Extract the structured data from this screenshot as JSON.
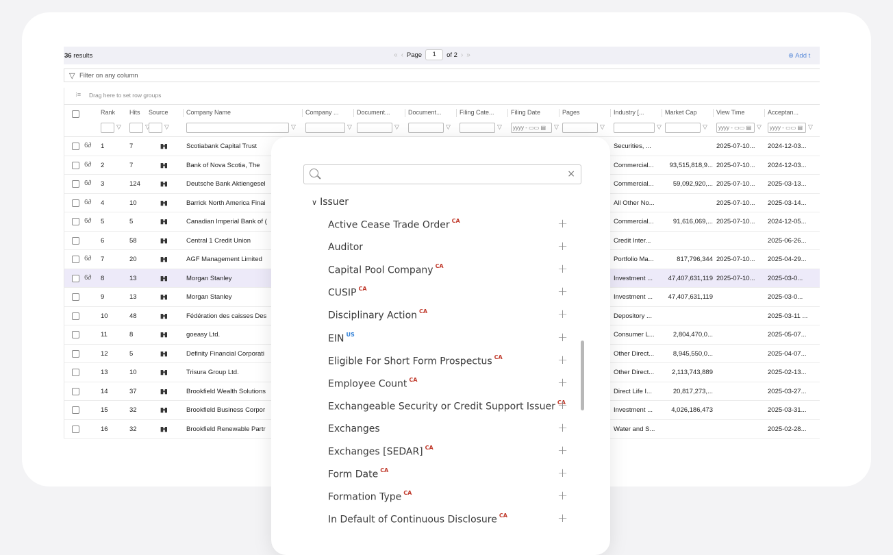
{
  "toolbar": {
    "results_count": "36",
    "results_label": "results",
    "page_label": "Page",
    "page_current": "1",
    "page_total": "of 2",
    "first_icon": "«",
    "prev_icon": "‹",
    "next_icon": "›",
    "last_icon": "»",
    "add_label": "Add t"
  },
  "filter": {
    "placeholder": "Filter on any column"
  },
  "row_groups": {
    "label": "Drag here to set row groups"
  },
  "columns": [
    "Rank",
    "Hits",
    "Source",
    "Company Name",
    "Company ...",
    "Document...",
    "Document...",
    "Filing Cate...",
    "Filing Date",
    "Pages",
    "Industry [...",
    "Market Cap",
    "View Time",
    "Acceptan..."
  ],
  "date_placeholder": "yyyy - ▭▭ ▤",
  "rows": [
    {
      "eye": true,
      "rank": "1",
      "hits": "7",
      "company": "Scotiabank Capital Trust",
      "industry": "Securities, ...",
      "cap": "",
      "view": "2025-07-10...",
      "accept": "2024-12-03...",
      "selected": false
    },
    {
      "eye": true,
      "rank": "2",
      "hits": "7",
      "company": "Bank of Nova Scotia, The",
      "industry": "Commercial...",
      "cap": "93,515,818,9...",
      "view": "2025-07-10...",
      "accept": "2024-12-03...",
      "selected": false
    },
    {
      "eye": true,
      "rank": "3",
      "hits": "124",
      "company": "Deutsche Bank Aktiengesel",
      "industry": "Commercial...",
      "cap": "59,092,920,...",
      "view": "2025-07-10...",
      "accept": "2025-03-13...",
      "selected": false
    },
    {
      "eye": true,
      "rank": "4",
      "hits": "10",
      "company": "Barrick North America Finai",
      "industry": "All Other No...",
      "cap": "",
      "view": "2025-07-10...",
      "accept": "2025-03-14...",
      "selected": false
    },
    {
      "eye": true,
      "rank": "5",
      "hits": "5",
      "company": "Canadian Imperial Bank of (",
      "industry": "Commercial...",
      "cap": "91,616,069,...",
      "view": "2025-07-10...",
      "accept": "2024-12-05...",
      "selected": false
    },
    {
      "eye": false,
      "rank": "6",
      "hits": "58",
      "company": "Central 1 Credit Union",
      "industry": "Credit Inter...",
      "cap": "",
      "view": "",
      "accept": "2025-06-26...",
      "selected": false
    },
    {
      "eye": true,
      "rank": "7",
      "hits": "20",
      "company": "AGF Management Limited",
      "industry": "Portfolio Ma...",
      "cap": "817,796,344",
      "view": "2025-07-10...",
      "accept": "2025-04-29...",
      "selected": false
    },
    {
      "eye": true,
      "rank": "8",
      "hits": "13",
      "company": "Morgan Stanley",
      "industry": "Investment ...",
      "cap": "47,407,631,119",
      "view": "2025-07-10...",
      "accept": "2025-03-0...",
      "selected": true
    },
    {
      "eye": false,
      "rank": "9",
      "hits": "13",
      "company": "Morgan Stanley",
      "industry": "Investment ...",
      "cap": "47,407,631,119",
      "view": "",
      "accept": "2025-03-0...",
      "selected": false
    },
    {
      "eye": false,
      "rank": "10",
      "hits": "48",
      "company": "Fédération des caisses Des",
      "industry": "Depository ...",
      "cap": "",
      "view": "",
      "accept": "2025-03-11 ...",
      "selected": false
    },
    {
      "eye": false,
      "rank": "11",
      "hits": "8",
      "company": "goeasy Ltd.",
      "industry": "Consumer L...",
      "cap": "2,804,470,0...",
      "view": "",
      "accept": "2025-05-07...",
      "selected": false
    },
    {
      "eye": false,
      "rank": "12",
      "hits": "5",
      "company": "Definity Financial Corporati",
      "industry": "Other Direct...",
      "cap": "8,945,550,0...",
      "view": "",
      "accept": "2025-04-07...",
      "selected": false
    },
    {
      "eye": false,
      "rank": "13",
      "hits": "10",
      "company": "Trisura Group Ltd.",
      "industry": "Other Direct...",
      "cap": "2,113,743,889",
      "view": "",
      "accept": "2025-02-13...",
      "selected": false
    },
    {
      "eye": false,
      "rank": "14",
      "hits": "37",
      "company": "Brookfield Wealth Solutions",
      "industry": "Direct Life I...",
      "cap": "20,817,273,...",
      "view": "",
      "accept": "2025-03-27...",
      "selected": false
    },
    {
      "eye": false,
      "rank": "15",
      "hits": "32",
      "company": "Brookfield Business Corpor",
      "industry": "Investment ...",
      "cap": "4,026,186,473",
      "view": "",
      "accept": "2025-03-31...",
      "selected": false
    },
    {
      "eye": false,
      "rank": "16",
      "hits": "32",
      "company": "Brookfield Renewable Partr",
      "industry": "Water and S...",
      "cap": "",
      "view": "",
      "accept": "2025-02-28...",
      "selected": false
    }
  ],
  "dropdown": {
    "search_value": "",
    "group_label": "Issuer",
    "items": [
      {
        "label": "Active Cease Trade Order",
        "tag": "CA"
      },
      {
        "label": "Auditor",
        "tag": ""
      },
      {
        "label": "Capital Pool Company",
        "tag": "CA"
      },
      {
        "label": "CUSIP",
        "tag": "CA"
      },
      {
        "label": "Disciplinary Action",
        "tag": "CA"
      },
      {
        "label": "EIN",
        "tag": "US"
      },
      {
        "label": "Eligible For Short Form Prospectus",
        "tag": "CA"
      },
      {
        "label": "Employee Count",
        "tag": "CA"
      },
      {
        "label": "Exchangeable Security or Credit Support Issuer",
        "tag": "CA"
      },
      {
        "label": "Exchanges",
        "tag": ""
      },
      {
        "label": "Exchanges [SEDAR]",
        "tag": "CA"
      },
      {
        "label": "Form Date",
        "tag": "CA"
      },
      {
        "label": "Formation Type",
        "tag": "CA"
      },
      {
        "label": "In Default of Continuous Disclosure",
        "tag": "CA"
      }
    ]
  },
  "colors": {
    "selected_row": "#edeaf9",
    "ca_tag": "#c0392b",
    "us_tag": "#2f7fd6",
    "accent": "#5b8bd9"
  }
}
